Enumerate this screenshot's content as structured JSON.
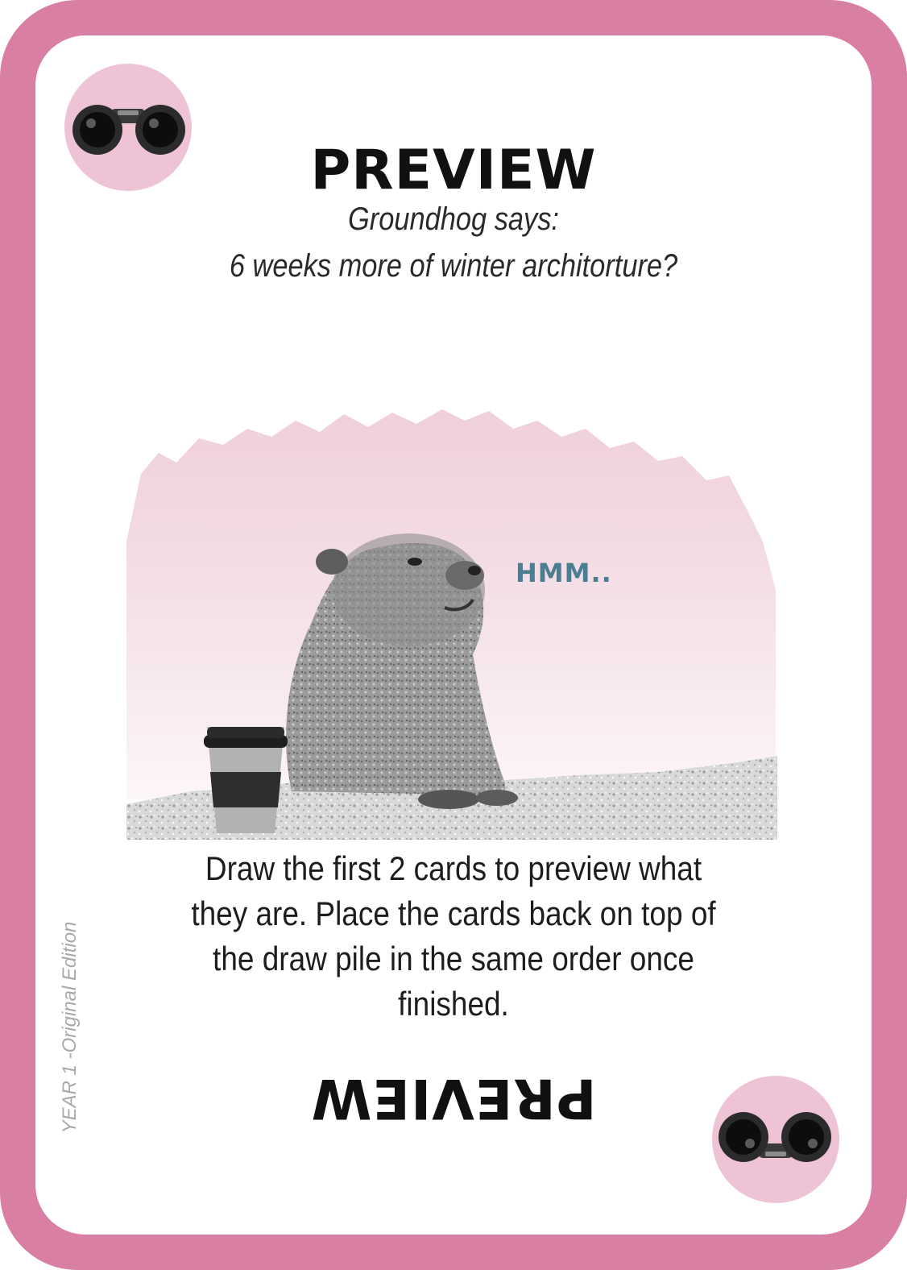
{
  "card": {
    "title": "PREVIEW",
    "subtitle_line1": "Groundhog says:",
    "subtitle_line2": "6 weeks more of winter architorture?",
    "speech": "HMM..",
    "description": "Draw the first 2 cards to preview what they are. Place the cards back on top of the draw pile in the same order once finished.",
    "title_flipped": "PREVIEW",
    "edition": "YEAR 1 -Original Edition"
  },
  "icons": {
    "corner_top_left": "binoculars-icon",
    "corner_bottom_right": "binoculars-icon"
  },
  "colors": {
    "border": "#d97fa4",
    "badge": "#edc3d5",
    "speech": "#4c7e91",
    "wash": "#f2d2df"
  }
}
